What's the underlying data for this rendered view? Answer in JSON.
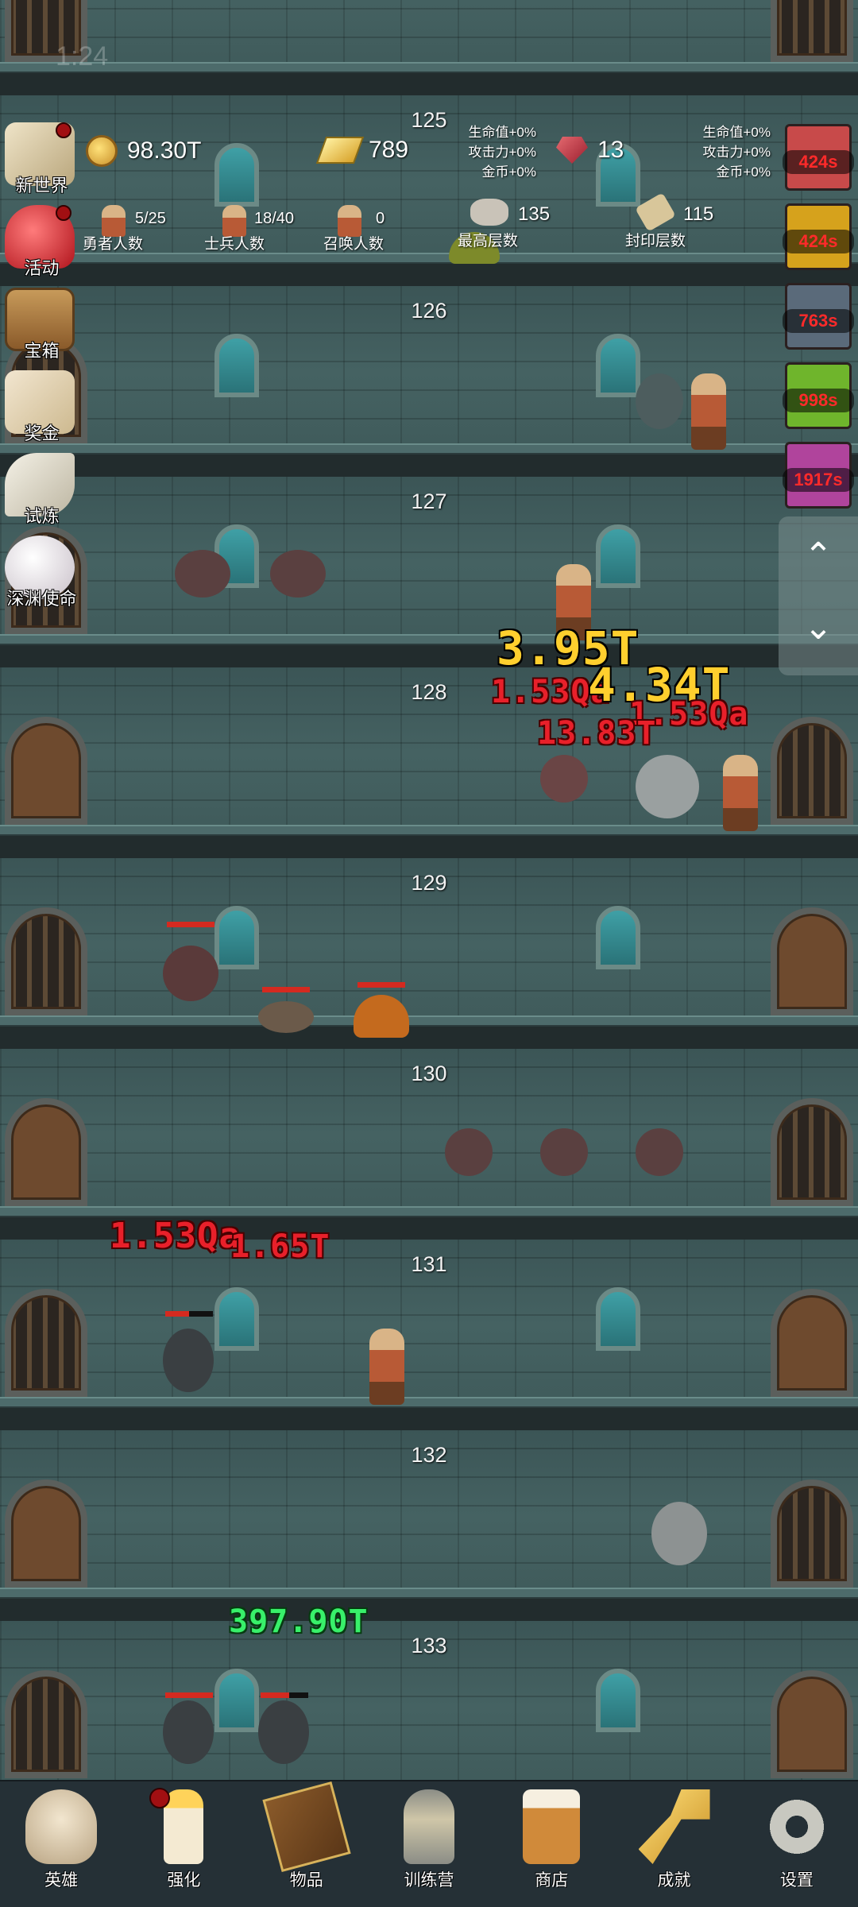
{
  "status_bar": {
    "time": "1:24"
  },
  "floors": [
    "125",
    "126",
    "127",
    "128",
    "129",
    "130",
    "131",
    "132",
    "133"
  ],
  "resources": {
    "coins": "98.30T",
    "gold": "789",
    "gems": "13"
  },
  "bonus_left": {
    "hp": "生命值+0%",
    "atk": "攻击力+0%",
    "gold": "金币+0%"
  },
  "bonus_right": {
    "hp": "生命值+0%",
    "atk": "攻击力+0%",
    "gold": "金币+0%"
  },
  "stats": {
    "heroes": {
      "count": "5/25",
      "label": "勇者人数"
    },
    "soldiers": {
      "count": "18/40",
      "label": "士兵人数"
    },
    "summons": {
      "count": "0",
      "label": "召唤人数"
    },
    "highest": {
      "count": "135",
      "label": "最高层数"
    },
    "sealed": {
      "count": "115",
      "label": "封印层数"
    }
  },
  "left_menu": [
    {
      "label": "新世界",
      "icon": "map-icon",
      "badge": true
    },
    {
      "label": "活动",
      "icon": "heart-icon",
      "badge": true
    },
    {
      "label": "宝箱",
      "icon": "chest-icon",
      "badge": false
    },
    {
      "label": "奖金",
      "icon": "envelope-icon",
      "badge": false
    },
    {
      "label": "试炼",
      "icon": "feather-icon",
      "badge": false
    },
    {
      "label": "深渊使命",
      "icon": "pearl-icon",
      "badge": false
    }
  ],
  "timers": [
    {
      "text": "424s",
      "color": "#c84a4a",
      "icon": "potion-red-icon"
    },
    {
      "text": "424s",
      "color": "#d6a21c",
      "icon": "potion-gold-icon"
    },
    {
      "text": "763s",
      "color": "#5a6a7a",
      "icon": "potion-blue-icon"
    },
    {
      "text": "998s",
      "color": "#6fb52c",
      "icon": "potion-green-icon"
    },
    {
      "text": "1917s",
      "color": "#b0449c",
      "icon": "potion-purple-icon"
    }
  ],
  "damage_numbers": [
    {
      "text": "3.95T",
      "color": "yellow"
    },
    {
      "text": "1.53Qa",
      "color": "red"
    },
    {
      "text": "4.34T",
      "color": "yellow"
    },
    {
      "text": "1.53Qa",
      "color": "red"
    },
    {
      "text": "13.83T",
      "color": "red"
    },
    {
      "text": "1.53Qa",
      "color": "red"
    },
    {
      "text": "1.65T",
      "color": "red"
    },
    {
      "text": "397.90T",
      "color": "green"
    }
  ],
  "scroll": {
    "up": "⌃",
    "down": "⌄"
  },
  "bottom_nav": [
    {
      "label": "英雄",
      "icon": "skull-icon",
      "badge": false
    },
    {
      "label": "强化",
      "icon": "candle-icon",
      "badge": true
    },
    {
      "label": "物品",
      "icon": "book-icon",
      "badge": false
    },
    {
      "label": "训练营",
      "icon": "lantern-icon",
      "badge": false
    },
    {
      "label": "商店",
      "icon": "beer-mug-icon",
      "badge": false
    },
    {
      "label": "成就",
      "icon": "key-icon",
      "badge": false
    },
    {
      "label": "设置",
      "icon": "gear-icon",
      "badge": false
    }
  ],
  "colors": {
    "hp_bar": "#d42a20",
    "timer_text": "#ff2a2a",
    "nav_bg": "#253036"
  }
}
